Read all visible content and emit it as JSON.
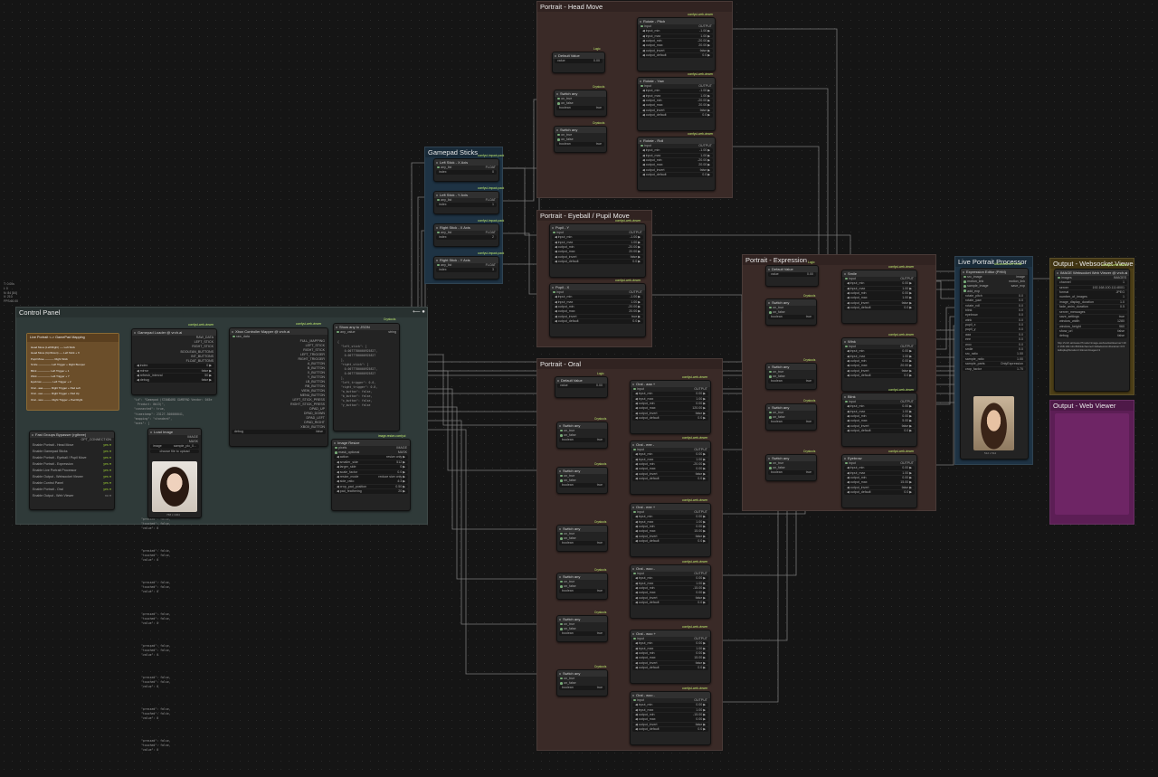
{
  "groups": {
    "head_move": {
      "title": "Portrait - Head Move",
      "color": "#3b2a28"
    },
    "eyeball": {
      "title": "Portrait - Eyeball / Pupil Move",
      "color": "#3b2a28"
    },
    "oral": {
      "title": "Portrait - Oral",
      "color": "#3b2a28"
    },
    "expression": {
      "title": "Portrait - Expression",
      "color": "#3b2a28"
    },
    "gamepad": {
      "title": "Gamepad Sticks",
      "color": "#24384a"
    },
    "live": {
      "title": "Live Portrait Processor",
      "color": "#24384a"
    },
    "ws_viewer": {
      "title": "Output - Websocket Viewer",
      "color": "#5a4a1a"
    },
    "web_viewer": {
      "title": "Output - Web Viewer",
      "color": "#5a1f52"
    },
    "control": {
      "title": "Control Panel",
      "color": "#3a4544"
    }
  },
  "labels": {
    "comfyui_web_viewer": "comfyui-web-viewer",
    "crystools": "Crystools",
    "logic": "Logic",
    "impact": "comfyui-impact-pack",
    "output": "OUTPUT",
    "float": "FLOAT"
  },
  "head_move": {
    "default_value": {
      "title": "Default Value",
      "label": "value",
      "value": "0.00"
    },
    "rotate_pitch": {
      "title": "Rotate - Pitch",
      "input": "input",
      "output": "OUTPUT",
      "rows": [
        [
          "input_min",
          "-1.00"
        ],
        [
          "input_max",
          "1.00"
        ],
        [
          "output_min",
          "-20.00"
        ],
        [
          "output_max",
          "20.00"
        ],
        [
          "output_invert",
          "false"
        ],
        [
          "output_default",
          "0.0"
        ]
      ]
    },
    "rotate_yaw": {
      "title": "Rotate - Yaw",
      "input": "input",
      "output": "OUTPUT",
      "rows": [
        [
          "input_min",
          "-1.00"
        ],
        [
          "input_max",
          "1.00"
        ],
        [
          "output_min",
          "-20.00"
        ],
        [
          "output_max",
          "20.00"
        ],
        [
          "output_invert",
          "false"
        ],
        [
          "output_default",
          "0.0"
        ]
      ]
    },
    "rotate_roll": {
      "title": "Rotate - Roll",
      "input": "input",
      "output": "OUTPUT",
      "rows": [
        [
          "input_min",
          "-1.00"
        ],
        [
          "input_max",
          "1.00"
        ],
        [
          "output_min",
          "-20.00"
        ],
        [
          "output_max",
          "20.00"
        ],
        [
          "output_invert",
          "false"
        ],
        [
          "output_default",
          "0.0"
        ]
      ]
    },
    "switch": {
      "title": "Switch any",
      "on_true": "on_true",
      "on_false": "on_false",
      "boolean": "boolean",
      "value": "true"
    }
  },
  "eyeball": {
    "pupil_x": {
      "title": "Pupil - Y",
      "rows": [
        [
          "input_min",
          "-1.00"
        ],
        [
          "input_max",
          "1.00"
        ],
        [
          "output_min",
          "-20.00"
        ],
        [
          "output_max",
          "20.00"
        ],
        [
          "output_invert",
          "false"
        ],
        [
          "output_default",
          "0.0"
        ]
      ]
    },
    "pupil_y": {
      "title": "Pupil - X",
      "rows": [
        [
          "input_min",
          "-1.00"
        ],
        [
          "input_max",
          "1.00"
        ],
        [
          "output_min",
          "-20.00"
        ],
        [
          "output_max",
          "20.00"
        ],
        [
          "output_invert",
          "true"
        ],
        [
          "output_default",
          "0.0"
        ]
      ]
    }
  },
  "oral": {
    "default_value": {
      "title": "Default Value",
      "label": "value",
      "value": "0.00"
    },
    "nodes": [
      {
        "title": "Oral - aaa +",
        "rows": [
          [
            "input_min",
            "0.00"
          ],
          [
            "input_max",
            "1.00"
          ],
          [
            "output_min",
            "0.00"
          ],
          [
            "output_max",
            "120.00"
          ],
          [
            "output_invert",
            "false"
          ],
          [
            "output_default",
            "0.0"
          ]
        ]
      },
      {
        "title": "Oral - eee -",
        "rows": [
          [
            "input_min",
            "0.00"
          ],
          [
            "input_max",
            "1.00"
          ],
          [
            "output_min",
            "-20.00"
          ],
          [
            "output_max",
            "0.00"
          ],
          [
            "output_invert",
            "false"
          ],
          [
            "output_default",
            "0.0"
          ]
        ]
      },
      {
        "title": "Oral - eee +",
        "rows": [
          [
            "input_min",
            "0.00"
          ],
          [
            "input_max",
            "1.00"
          ],
          [
            "output_min",
            "0.00"
          ],
          [
            "output_max",
            "15.00"
          ],
          [
            "output_invert",
            "false"
          ],
          [
            "output_default",
            "0.0"
          ]
        ]
      },
      {
        "title": "Oral - woo -",
        "rows": [
          [
            "input_min",
            "0.00"
          ],
          [
            "input_max",
            "1.00"
          ],
          [
            "output_min",
            "-15.00"
          ],
          [
            "output_max",
            "0.00"
          ],
          [
            "output_invert",
            "false"
          ],
          [
            "output_default",
            "0.0"
          ]
        ]
      },
      {
        "title": "Oral - woo +",
        "rows": [
          [
            "input_min",
            "0.00"
          ],
          [
            "input_max",
            "1.00"
          ],
          [
            "output_min",
            "0.00"
          ],
          [
            "output_max",
            "15.00"
          ],
          [
            "output_invert",
            "false"
          ],
          [
            "output_default",
            "0.0"
          ]
        ]
      },
      {
        "title": "Oral - woo -",
        "rows": [
          [
            "input_min",
            "0.00"
          ],
          [
            "input_max",
            "1.00"
          ],
          [
            "output_min",
            "-15.00"
          ],
          [
            "output_max",
            "0.00"
          ],
          [
            "output_invert",
            "false"
          ],
          [
            "output_default",
            "0.0"
          ]
        ]
      }
    ]
  },
  "expression": {
    "default_value": {
      "title": "Default Value",
      "label": "value",
      "value": "0.00"
    },
    "nodes": [
      {
        "title": "Smile",
        "rows": [
          [
            "input_min",
            "0.00"
          ],
          [
            "input_max",
            "1.00"
          ],
          [
            "output_min",
            "0.00"
          ],
          [
            "output_max",
            "1.00"
          ],
          [
            "output_invert",
            "false"
          ],
          [
            "output_default",
            "0.0"
          ]
        ]
      },
      {
        "title": "Wink",
        "rows": [
          [
            "input_min",
            "0.00"
          ],
          [
            "input_max",
            "1.00"
          ],
          [
            "output_min",
            "0.00"
          ],
          [
            "output_max",
            "20.00"
          ],
          [
            "output_invert",
            "false"
          ],
          [
            "output_default",
            "0.0"
          ]
        ]
      },
      {
        "title": "Blink",
        "rows": [
          [
            "input_min",
            "0.00"
          ],
          [
            "input_max",
            "1.00"
          ],
          [
            "output_min",
            "0.00"
          ],
          [
            "output_max",
            "5.00"
          ],
          [
            "output_invert",
            "false"
          ],
          [
            "output_default",
            "0.0"
          ]
        ]
      },
      {
        "title": "Eyebrow",
        "rows": [
          [
            "input_min",
            "0.00"
          ],
          [
            "input_max",
            "1.00"
          ],
          [
            "output_min",
            "0.00"
          ],
          [
            "output_max",
            "15.00"
          ],
          [
            "output_invert",
            "false"
          ],
          [
            "output_default",
            "0.0"
          ]
        ]
      }
    ]
  },
  "gamepad": {
    "nodes": [
      {
        "title": "Left Stick - X Axis",
        "in": "any_list",
        "out": "FLOAT",
        "w_label": "index",
        "w_value": "0"
      },
      {
        "title": "Left Stick - Y Axis",
        "in": "any_list",
        "out": "FLOAT",
        "w_label": "index",
        "w_value": "1"
      },
      {
        "title": "Right Stick - X Axis",
        "in": "any_list",
        "out": "FLOAT",
        "w_label": "index",
        "w_value": "2"
      },
      {
        "title": "Right Stick - Y Axis",
        "in": "any_list",
        "out": "FLOAT",
        "w_label": "index",
        "w_value": "3"
      }
    ]
  },
  "live": {
    "title": "Expression Editor (PHM)",
    "badge": "AdvancedLivePortrait",
    "inputs": [
      "src_image",
      "motion_link",
      "sample_image",
      "add_exp"
    ],
    "outputs": [
      "image",
      "motion_link",
      "save_exp"
    ],
    "params": [
      [
        "rotate_pitch",
        "0.0"
      ],
      [
        "rotate_yaw",
        "0.0"
      ],
      [
        "rotate_roll",
        "0.0"
      ],
      [
        "blink",
        "0.0"
      ],
      [
        "eyebrow",
        "0.0"
      ],
      [
        "wink",
        "0.0"
      ],
      [
        "pupil_x",
        "0.0"
      ],
      [
        "pupil_y",
        "0.0"
      ],
      [
        "aaa",
        "0.0"
      ],
      [
        "eee",
        "0.0"
      ],
      [
        "woo",
        "0.0"
      ],
      [
        "smile",
        "0.0"
      ],
      [
        "src_ratio",
        "1.00"
      ],
      [
        "sample_ratio",
        "1.00"
      ],
      [
        "sample_parts",
        "OnlyExpression"
      ],
      [
        "crop_factor",
        "1.70"
      ]
    ],
    "image_caption": "512 x 512"
  },
  "ws_viewer": {
    "title": "IMAGE Websocket Web Viewer @ vrch.ai",
    "input": "images",
    "output": "IMAGES",
    "rows": [
      [
        "channel",
        "1"
      ],
      [
        "server",
        "192.168.100.111:8001"
      ],
      [
        "format",
        "JPEG"
      ],
      [
        "number_of_images",
        "1"
      ],
      [
        "image_display_duration",
        "1.0"
      ],
      [
        "fade_anim_duration",
        "0.5"
      ],
      [
        "server_messages",
        ""
      ],
      [
        "save_settings",
        "true"
      ],
      [
        "window_width",
        "1280"
      ],
      [
        "window_height",
        "960"
      ],
      [
        "show_url",
        "false"
      ],
      [
        "debug",
        "false"
      ]
    ],
    "url_text": "http://vrch.ai/viewer?mode=image-websocket&server=192.168.100.111:8001&channel=1&fadeAnimDuration=0.5&displayDuration=1&numImages=1"
  },
  "control": {
    "mapping_title": "Live Portrait <-> GamePad Mapping",
    "mapping_lines": [
      "Head Move (Left/Right) ---- Left Stick",
      "Head Move (Up/Down) ---- Left Stick + X",
      "Pupil Move ---------- Right Stick",
      "Smile -------------- Left Trigger + Right Bumper",
      "Blink -------------- Left Trigger + 1",
      "Wink -------------- Left Trigger + Y",
      "Eyebrow ----------- Left Trigger + 2",
      "Oral - aaa -------- Right Trigger + Pad Left",
      "Oral - eee -------- Right Trigger + Pad Up",
      "Oral - woo -------- Right Trigger + Pad Right"
    ],
    "gamepad_loader": {
      "title": "Gamepad Loader @ vrch.ai",
      "outputs": [
        "RAW_DATA",
        "LEFT_STICK",
        "RIGHT_STICK",
        "BOOLEAN_BUTTONS",
        "INT_BUTTONS",
        "FLOAT_BUTTONS"
      ],
      "rows": [
        [
          "index",
          "0"
        ],
        [
          "mirror",
          "false"
        ],
        [
          "refresh_interval",
          "50"
        ],
        [
          "debug",
          "false"
        ]
      ]
    },
    "mapper": {
      "title": "Xbox Controller Mapper @ vrch.ai",
      "input": "raw_data",
      "outputs": [
        "FULL_MAPPING",
        "LEFT_STICK",
        "RIGHT_STICK",
        "LEFT_TRIGGER",
        "RIGHT_TRIGGER",
        "A_BUTTON",
        "B_BUTTON",
        "X_BUTTON",
        "Y_BUTTON",
        "LB_BUTTON",
        "RB_BUTTON",
        "VIEW_BUTTON",
        "MENU_BUTTON",
        "LEFT_STICK_PRESS",
        "RIGHT_STICK_PRESS",
        "DPAD_UP",
        "DPAD_DOWN",
        "DPAD_LEFT",
        "DPAD_RIGHT",
        "XBOX_BUTTON"
      ],
      "debug": "debug",
      "debug_value": "false"
    },
    "show_json": {
      "title": "Show any to JSON",
      "input": "any_value",
      "output": "string",
      "text": "{\n  \"left_stick\": [\n    0.0077780000925827,\n    0.0077780000925827\n  ],\n  \"right_stick\": [\n    0.0077780000925827,\n    0.0077780000925827\n  ],\n  \"left_trigger\": 0.0,\n  \"right_trigger\": 0.0,\n  \"a_button\": false,\n  \"b_button\": false,\n  \"x_button\": false,\n  \"y_button\": false"
    },
    "raw_dump": "\"id\": \"Gamepad (STANDARD GAMEPAD Vendor: 045e\n  Product: 0b13)\",\n\"connected\": true,\n\"timestamp\": 23127.300000041,\n\"mapping\": \"standard\",\n\"axes\": [",
    "fast_groups": {
      "title": "Fast Groups Bypasser (rgthree)",
      "output": "OPT_CONNECTION",
      "items": [
        [
          "Enable Portrait - Head Move",
          "yes"
        ],
        [
          "Enable Gamepad Sticks",
          "yes"
        ],
        [
          "Enable Portrait - Eyeball / Pupil Move",
          "yes"
        ],
        [
          "Enable Portrait - Expression",
          "yes"
        ],
        [
          "Enable Live Portrait Processor",
          "yes"
        ],
        [
          "Enable Output - Websocket Viewer",
          "yes"
        ],
        [
          "Enable Control Panel",
          "yes"
        ],
        [
          "Enable Portrait - Oral",
          "yes"
        ],
        [
          "Enable Output - Web Viewer",
          "no"
        ]
      ]
    },
    "load_image": {
      "title": "Load Image",
      "outputs": [
        "IMAGE",
        "MASK"
      ],
      "file_label": "image",
      "file_value": "sample_pic_0...",
      "button": "choose file to upload",
      "caption": "768 x 1024"
    },
    "resize": {
      "title": "Image Resize",
      "inputs": [
        "pixels",
        "mask_optional"
      ],
      "outputs": [
        "IMAGE",
        "MASK"
      ],
      "rows": [
        [
          "action",
          "resize only"
        ],
        [
          "smaller_side",
          "512"
        ],
        [
          "larger_side",
          "0"
        ],
        [
          "scale_factor",
          "0.0"
        ],
        [
          "resize_mode",
          "reduce size only"
        ],
        [
          "side_ratio",
          "4:3"
        ],
        [
          "crop_pad_position",
          "0.50"
        ],
        [
          "pad_feathering",
          "20"
        ]
      ],
      "badge": "image-resize-comfyui"
    }
  },
  "buttons_dump": "\"pressed\": false,\n\"touched\": false,\n\"value\": 0",
  "top_left_info": "T: 0.00s\nI: 0\nN: 84 [84]\nV: 210\nFPS:60.00"
}
